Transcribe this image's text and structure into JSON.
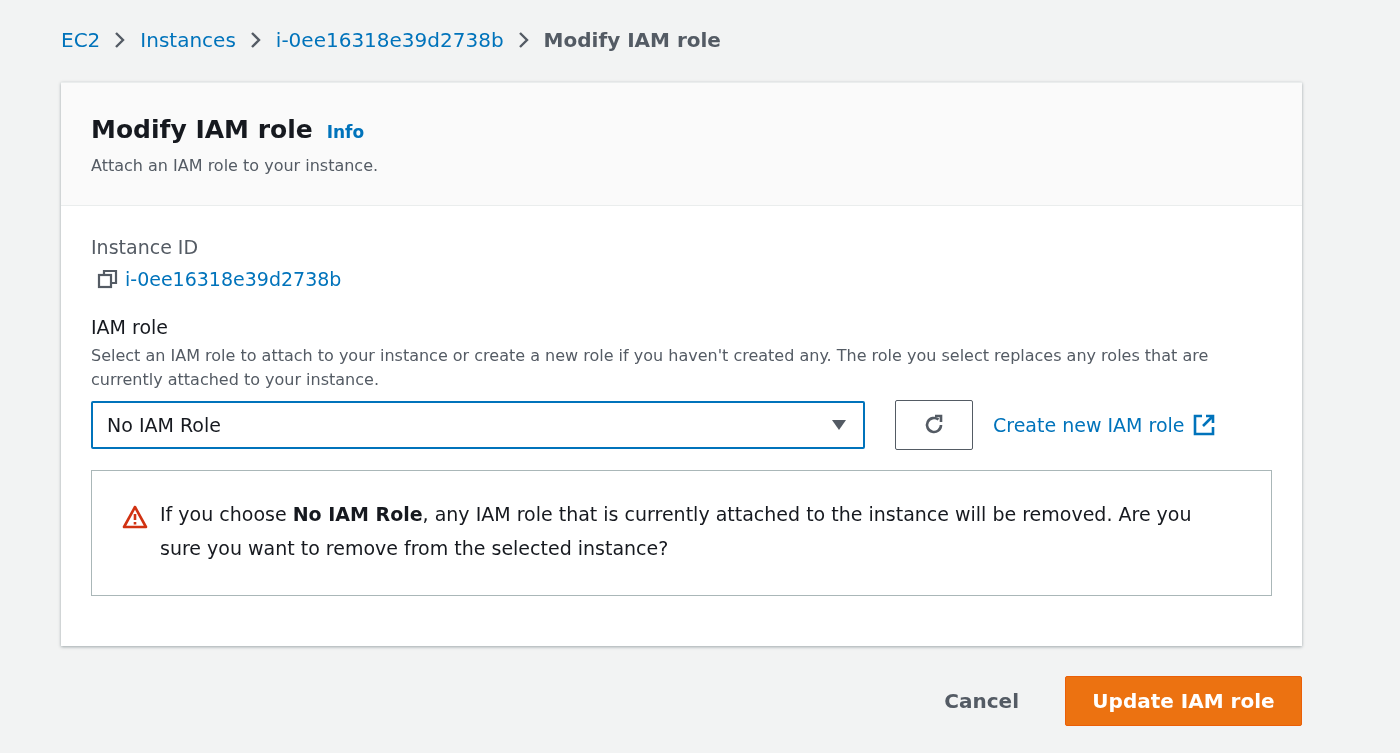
{
  "breadcrumbs": {
    "links": [
      "EC2",
      "Instances",
      "i-0ee16318e39d2738b"
    ],
    "current": "Modify IAM role"
  },
  "panel": {
    "title": "Modify IAM role",
    "info_link": "Info",
    "description": "Attach an IAM role to your instance."
  },
  "instance_id": {
    "label": "Instance ID",
    "value": "i-0ee16318e39d2738b"
  },
  "iam_role": {
    "label": "IAM role",
    "description": "Select an IAM role to attach to your instance or create a new role if you haven't created any. The role you select replaces any roles that are currently attached to your instance.",
    "value": "No IAM Role",
    "create_link": "Create new IAM role"
  },
  "warning": {
    "text": "If you choose **No IAM Role**, any IAM role that is currently attached to the instance will be removed. Are you sure you want to remove from the selected instance?"
  },
  "buttons": {
    "cancel": "Cancel",
    "submit": "Update IAM role"
  }
}
